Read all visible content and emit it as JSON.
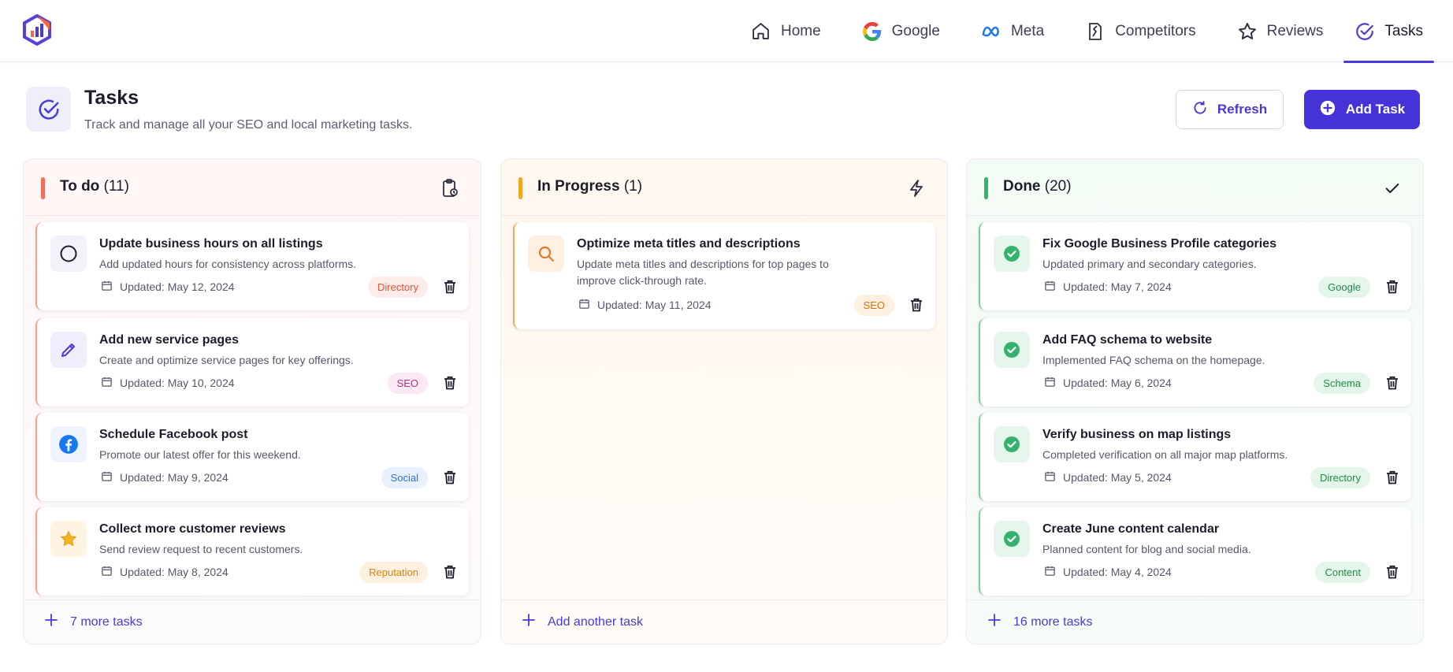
{
  "nav": {
    "items": [
      {
        "label": "Home",
        "icon": "home-icon"
      },
      {
        "label": "Google",
        "icon": "google-icon"
      },
      {
        "label": "Meta",
        "icon": "meta-icon"
      },
      {
        "label": "Competitors",
        "icon": "competitors-icon"
      },
      {
        "label": "Reviews",
        "icon": "star-icon"
      },
      {
        "label": "Tasks",
        "icon": "check-circle-icon",
        "active": true
      }
    ]
  },
  "header": {
    "title": "Tasks",
    "subtitle": "Track and manage all your SEO and local marketing tasks.",
    "refresh_label": "Refresh",
    "add_label": "Add Task"
  },
  "columns": {
    "todo": {
      "title": "To do",
      "count": "(11)",
      "accent": "#f26d5b",
      "footer": "7 more tasks",
      "cards": [
        {
          "title": "Update business hours on all listings",
          "desc": "Add updated hours for consistency across platforms.",
          "date": "Updated: May 12, 2024",
          "tag": "Directory",
          "icon": "circle-icon"
        },
        {
          "title": "Add new service pages",
          "desc": "Create and optimize service pages for key offerings.",
          "date": "Updated: May 10, 2024",
          "tag": "SEO",
          "icon": "pencil-icon"
        },
        {
          "title": "Schedule Facebook post",
          "desc": "Promote our latest offer for this weekend.",
          "date": "Updated: May 9, 2024",
          "tag": "Social",
          "icon": "facebook-icon"
        },
        {
          "title": "Collect more customer reviews",
          "desc": "Send review request to recent customers.",
          "date": "Updated: May 8, 2024",
          "tag": "Reputation",
          "icon": "star-icon"
        }
      ]
    },
    "progress": {
      "title": "In Progress",
      "count": "(1)",
      "accent": "#f5a524",
      "footer": "Add another task",
      "cards": [
        {
          "title": "Optimize meta titles and descriptions",
          "desc": "Update meta titles and descriptions for top pages to improve click-through rate.",
          "date": "Updated: May 11, 2024",
          "tag": "SEO",
          "icon": "search-icon"
        }
      ]
    },
    "done": {
      "title": "Done",
      "count": "(20)",
      "accent": "#2fb46a",
      "footer": "16 more tasks",
      "cards": [
        {
          "title": "Fix Google Business Profile categories",
          "desc": "Updated primary and secondary categories.",
          "date": "Updated: May 7, 2024",
          "tag": "Google",
          "icon": "check-circle-icon"
        },
        {
          "title": "Add FAQ schema to website",
          "desc": "Implemented FAQ schema on the homepage.",
          "date": "Updated: May 6, 2024",
          "tag": "Schema",
          "icon": "check-circle-icon"
        },
        {
          "title": "Verify business on map listings",
          "desc": "Completed verification on all major map platforms.",
          "date": "Updated: May 5, 2024",
          "tag": "Directory",
          "icon": "check-circle-icon"
        },
        {
          "title": "Create June content calendar",
          "desc": "Planned content for blog and social media.",
          "date": "Updated: May 4, 2024",
          "tag": "Content",
          "icon": "check-circle-icon"
        }
      ]
    }
  }
}
